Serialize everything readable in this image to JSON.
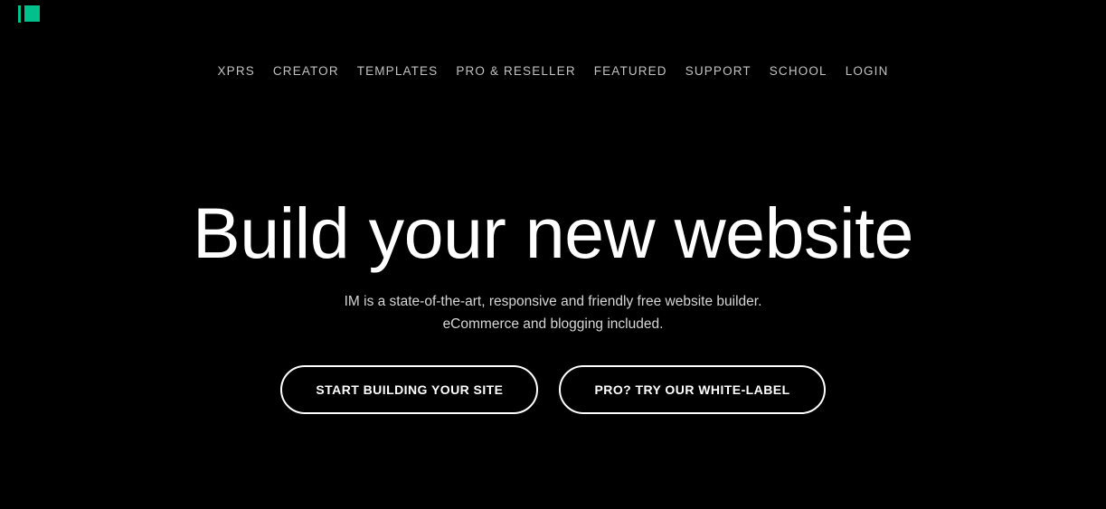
{
  "theme": {
    "background": "#000000",
    "accent": "#00c08b",
    "text_primary": "#ffffff",
    "text_muted": "#c2c2c2",
    "text_sub": "#d6d6d6"
  },
  "header": {
    "logo": {
      "icon": "im-logo-mark",
      "alt": "IM"
    },
    "nav": [
      {
        "label": "XPRS"
      },
      {
        "label": "CREATOR"
      },
      {
        "label": "TEMPLATES"
      },
      {
        "label": "PRO & RESELLER"
      },
      {
        "label": "FEATURED"
      },
      {
        "label": "SUPPORT"
      },
      {
        "label": "SCHOOL"
      },
      {
        "label": "LOGIN"
      }
    ]
  },
  "hero": {
    "title": "Build your new website",
    "subtitle_line1": "IM is a state-of-the-art, responsive and friendly free website builder.",
    "subtitle_line2": "eCommerce and blogging included.",
    "primary_cta": "START BUILDING YOUR SITE",
    "secondary_cta": "PRO? TRY OUR WHITE-LABEL"
  }
}
